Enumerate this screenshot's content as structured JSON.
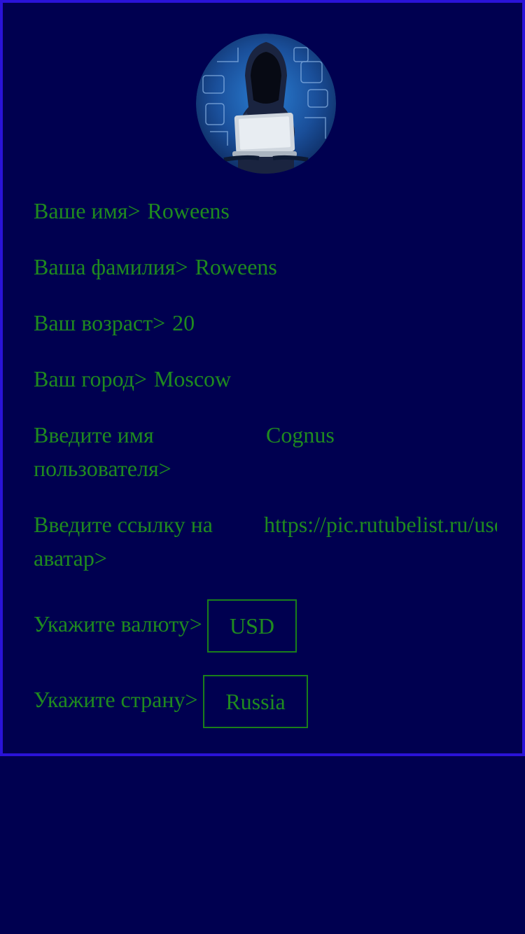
{
  "profile": {
    "avatar_icon": "hacker-avatar-icon",
    "first_name": {
      "label": "Ваше имя>",
      "value": "Roweens"
    },
    "last_name": {
      "label": "Ваша фамилия>",
      "value": "Roweens"
    },
    "age": {
      "label": "Ваш возраст>",
      "value": "20"
    },
    "city": {
      "label": "Ваш город>",
      "value": "Moscow"
    },
    "username": {
      "label_line1": "Введите имя",
      "label_line2": "пользователя>",
      "value": "Cognus"
    },
    "avatar_link": {
      "label_line1": "Введите ссылку на",
      "label_line2": "аватар>",
      "value": "https://pic.rutubelist.ru/user"
    },
    "currency": {
      "label": "Укажите валюту>",
      "value": "USD"
    },
    "country": {
      "label": "Укажите страну>",
      "value": "Russia"
    }
  },
  "colors": {
    "background": "#000050",
    "border": "#2a13d8",
    "text": "#1f8a1f"
  }
}
